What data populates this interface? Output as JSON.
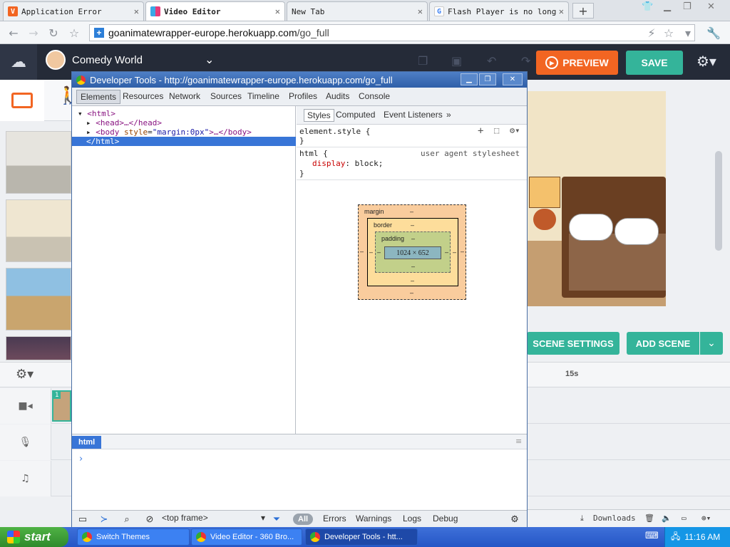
{
  "browser": {
    "tabs": [
      {
        "title": "Application Error",
        "favicon": "V",
        "favicon_color": "#f26522"
      },
      {
        "title": "Video Editor",
        "favicon": "",
        "favicon_color": "#e63b7a"
      },
      {
        "title": "New Tab",
        "favicon": "",
        "favicon_color": ""
      },
      {
        "title": "Flash Player is no longer",
        "favicon": "G",
        "favicon_color": "#4285f4"
      }
    ],
    "new_tab_label": "+",
    "close_glyph": "✕",
    "url_domain": "goanimatewrapper-europe.herokuapp.com",
    "url_path": "/go_full"
  },
  "app": {
    "project_name": "Comedy World",
    "preview_label": "PREVIEW",
    "save_label": "SAVE",
    "scene_settings_label": "SCENE SETTINGS",
    "add_scene_label": "ADD SCENE",
    "timeline_marker": "15s",
    "scene_badge": "1",
    "colors": {
      "preview": "#f26522",
      "save": "#34b49a",
      "header": "#252b38"
    }
  },
  "devtools": {
    "title": "Developer Tools - http://goanimatewrapper-europe.herokuapp.com/go_full",
    "tabs": [
      "Elements",
      "Resources",
      "Network",
      "Sources",
      "Timeline",
      "Profiles",
      "Audits",
      "Console"
    ],
    "active_tab": "Elements",
    "dom": {
      "html_open": "<html>",
      "head": "<head>…</head>",
      "body_tag": "<body",
      "body_attr_name": "style",
      "body_attr_value": "\"margin:0px\"",
      "body_rest": ">…</body>",
      "html_close": "</html>"
    },
    "styles_tabs": [
      "Styles",
      "Computed",
      "Event Listeners",
      "»"
    ],
    "element_style_open": "element.style {",
    "element_style_close": "}",
    "html_rule_selector": "html {",
    "html_rule_source": "user agent stylesheet",
    "html_rule_prop": "display",
    "html_rule_value": "block;",
    "html_rule_close": "}",
    "box_model": {
      "margin_label": "margin",
      "border_label": "border",
      "padding_label": "padding",
      "dash": "–",
      "content_size": "1024 × 652"
    },
    "breadcrumb": "html",
    "console_prompt": "›",
    "frame_select": "<top frame>",
    "filter_all": "All",
    "filters": [
      "Errors",
      "Warnings",
      "Logs",
      "Debug"
    ]
  },
  "status": {
    "downloads_label": "Downloads"
  },
  "taskbar": {
    "start_label": "start",
    "tasks": [
      "Switch Themes",
      "Video Editor - 360 Bro...",
      "Developer Tools - htt..."
    ],
    "clock": "11:16 AM"
  }
}
